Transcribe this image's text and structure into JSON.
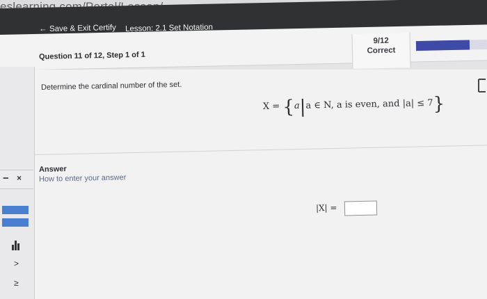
{
  "browser": {
    "url_fragment": "eslearning.com/Portal/Lesson/"
  },
  "header": {
    "back_arrow": "←",
    "save_exit_label": "Save & Exit Certify",
    "lesson_title": "Lesson: 2.1 Set Notation"
  },
  "question": {
    "title": "Question 11 of 12, Step 1 of 1",
    "score": "9/12",
    "status": "Correct",
    "progress_fraction": 0.75,
    "prompt": "Determine the cardinal number of the set.",
    "set_lhs": "X = ",
    "set_open": "{",
    "set_var": "a",
    "set_bar": "|",
    "set_cond": "a ∈ N, a is even, and |a| ≤ 7",
    "set_close": "}"
  },
  "answer": {
    "heading": "Answer",
    "help_link": "How to enter your answer",
    "label": "|X| =",
    "value": ""
  },
  "sidebar": {
    "minus_symbol": "−",
    "close_symbol": "×",
    "gt_symbol": ">",
    "ge_symbol": "≥"
  },
  "colors": {
    "header_bg": "#2f3135",
    "progress": "#3f4aa6",
    "palette_blue": "#4a7fcf"
  }
}
